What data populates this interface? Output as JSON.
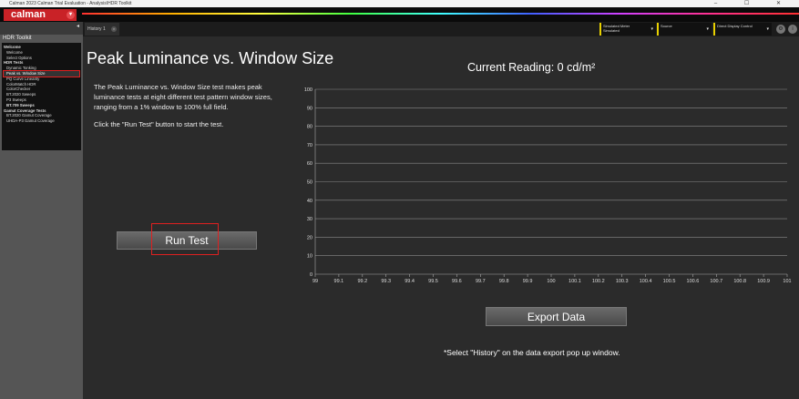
{
  "window": {
    "title": "Calman 2023 Calman Trial Evaluation - Analysis\\HDR Toolkit",
    "controls": [
      "–",
      "☐",
      "✕"
    ]
  },
  "app": {
    "logo_text": "calman",
    "logo_caret": "▾"
  },
  "sidebar": {
    "header": "HDR Toolkit",
    "tree": [
      {
        "label": "Welcome",
        "level": 0,
        "bold": true,
        "active": false
      },
      {
        "label": "Welcome",
        "level": 1,
        "bold": false,
        "active": false
      },
      {
        "label": "Select Options",
        "level": 1,
        "bold": false,
        "active": false
      },
      {
        "label": "HDR Tests",
        "level": 0,
        "bold": true,
        "active": false
      },
      {
        "label": "Dynamic Tonking",
        "level": 1,
        "bold": false,
        "active": false
      },
      {
        "label": "Peak vs. Window Size",
        "level": 1,
        "bold": false,
        "active": true
      },
      {
        "label": "PQ Curve Linearity",
        "level": 1,
        "bold": false,
        "active": false
      },
      {
        "label": "ColorMatch HDR",
        "level": 1,
        "bold": false,
        "active": false
      },
      {
        "label": "ColorChecker",
        "level": 1,
        "bold": false,
        "active": false
      },
      {
        "label": "BT.2020 Sweeps",
        "level": 1,
        "bold": false,
        "active": false
      },
      {
        "label": "P3 Sweeps",
        "level": 1,
        "bold": false,
        "active": false
      },
      {
        "label": "BT.709 Sweeps",
        "level": 1,
        "bold": true,
        "active": false
      },
      {
        "label": "Gamut Coverage Tests",
        "level": 0,
        "bold": true,
        "active": false
      },
      {
        "label": "BT.2020 Gamut Coverage",
        "level": 1,
        "bold": false,
        "active": false
      },
      {
        "label": "UHDA-P3 Gamut Coverage",
        "level": 1,
        "bold": false,
        "active": false
      }
    ]
  },
  "tabs": [
    {
      "label": "History 1"
    }
  ],
  "toolbar": {
    "dropdowns": [
      {
        "line1": "Simulated Meter",
        "line2": "Simulated"
      },
      {
        "line1": "Source",
        "line2": ""
      },
      {
        "line1": "Direct Display Control",
        "line2": ""
      }
    ]
  },
  "main": {
    "title": "Peak Luminance vs. Window Size",
    "description": "The Peak Luminance vs. Window Size test makes peak luminance tests at eight different test pattern window sizes, ranging from a 1% window to 100% full field.",
    "instruction": "Click the \"Run Test\" button to start the test.",
    "run_button": "Run Test",
    "current_reading": "Current Reading: 0 cd/m²",
    "export_button": "Export  Data",
    "footnote": "*Select \"History\" on the data export pop up window."
  },
  "colors": {
    "accent_red": "#e02020",
    "dropdown_accent": "#e8d000",
    "logo_red": "#c92227"
  },
  "chart_data": {
    "type": "line",
    "title": "",
    "xlabel": "",
    "ylabel": "",
    "x_ticks": [
      "99",
      "99.1",
      "99.2",
      "99.3",
      "99.4",
      "99.5",
      "99.6",
      "99.7",
      "99.8",
      "99.9",
      "100",
      "100.1",
      "100.2",
      "100.3",
      "100.4",
      "100.5",
      "100.6",
      "100.7",
      "100.8",
      "100.9",
      "101"
    ],
    "y_ticks": [
      "0",
      "10",
      "20",
      "30",
      "40",
      "50",
      "60",
      "70",
      "80",
      "90",
      "100"
    ],
    "xlim": [
      99,
      101
    ],
    "ylim": [
      0,
      100
    ],
    "grid": true,
    "series": []
  }
}
